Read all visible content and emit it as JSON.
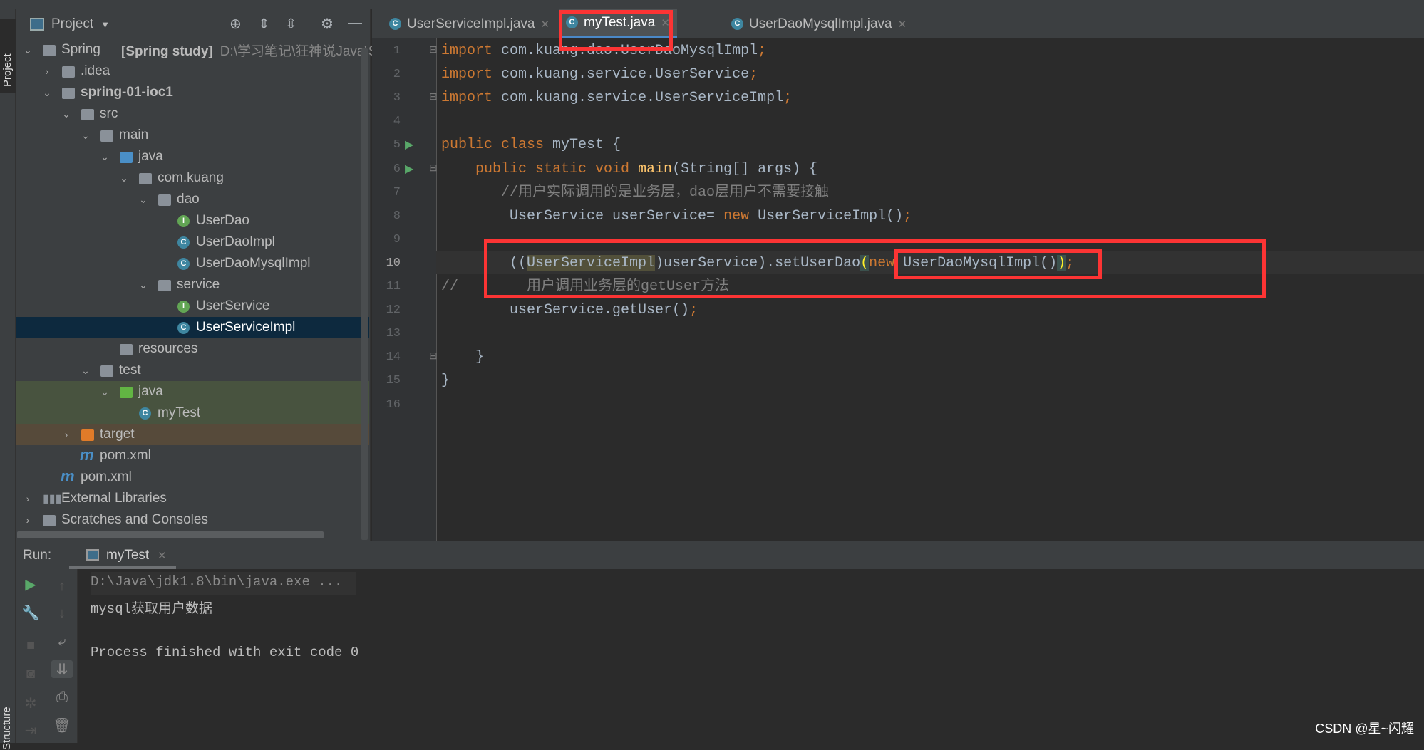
{
  "side_stripe": {
    "project_label": "Project",
    "structure_label": "Structure"
  },
  "project_panel": {
    "title": "Project",
    "tree": [
      {
        "depth": 0,
        "arrow": "down",
        "icon": "module",
        "label": "Spring",
        "bold_suffix": "[Spring study]",
        "path": "D:\\学习笔记\\狂神说Java\\Spr"
      },
      {
        "depth": 1,
        "arrow": "right",
        "icon": "folder",
        "label": ".idea"
      },
      {
        "depth": 1,
        "arrow": "down",
        "icon": "module",
        "label": "spring-01-ioc1",
        "bold": true
      },
      {
        "depth": 2,
        "arrow": "down",
        "icon": "folder",
        "label": "src"
      },
      {
        "depth": 3,
        "arrow": "down",
        "icon": "folder",
        "label": "main"
      },
      {
        "depth": 4,
        "arrow": "down",
        "icon": "source-folder",
        "label": "java"
      },
      {
        "depth": 5,
        "arrow": "down",
        "icon": "package",
        "label": "com.kuang"
      },
      {
        "depth": 6,
        "arrow": "down",
        "icon": "package",
        "label": "dao"
      },
      {
        "depth": 7,
        "icon": "interface",
        "label": "UserDao"
      },
      {
        "depth": 7,
        "icon": "class",
        "label": "UserDaoImpl"
      },
      {
        "depth": 7,
        "icon": "class",
        "label": "UserDaoMysqlImpl"
      },
      {
        "depth": 6,
        "arrow": "down",
        "icon": "package",
        "label": "service"
      },
      {
        "depth": 7,
        "icon": "interface",
        "label": "UserService"
      },
      {
        "depth": 7,
        "icon": "class",
        "label": "UserServiceImpl",
        "selected": true
      },
      {
        "depth": 4,
        "icon": "resources-folder",
        "label": "resources"
      },
      {
        "depth": 3,
        "arrow": "down",
        "icon": "folder",
        "label": "test"
      },
      {
        "depth": 4,
        "arrow": "down",
        "icon": "test-folder",
        "label": "java",
        "test": true
      },
      {
        "depth": 5,
        "icon": "test-class",
        "label": "myTest",
        "test": true
      },
      {
        "depth": 2,
        "arrow": "right",
        "icon": "excluded-folder",
        "label": "target",
        "excluded": true
      },
      {
        "depth": 2,
        "icon": "maven",
        "label": "pom.xml"
      },
      {
        "depth": 1,
        "icon": "maven",
        "label": "pom.xml"
      },
      {
        "depth": 0,
        "arrow": "right",
        "icon": "libraries",
        "label": "External Libraries"
      },
      {
        "depth": 0,
        "arrow": "right",
        "icon": "scratches",
        "label": "Scratches and Consoles"
      }
    ]
  },
  "editor_tabs": [
    {
      "label": "UserServiceImpl.java",
      "active": false
    },
    {
      "label": "myTest.java",
      "active": true
    },
    {
      "label": "UserDaoMysqlImpl.java",
      "active": false
    }
  ],
  "code_lines": [
    {
      "n": "1",
      "tokens": [
        [
          "import",
          "kw"
        ],
        [
          " com.kuang.dao.UserDaoMysqlImpl",
          "tx"
        ],
        [
          ";",
          "kw"
        ]
      ]
    },
    {
      "n": "2",
      "tokens": [
        [
          "import",
          "kw"
        ],
        [
          " com.kuang.service.UserService",
          "tx"
        ],
        [
          ";",
          "kw"
        ]
      ]
    },
    {
      "n": "3",
      "tokens": [
        [
          "import",
          "kw"
        ],
        [
          " com.kuang.service.UserServiceImpl",
          "tx"
        ],
        [
          ";",
          "kw"
        ]
      ]
    },
    {
      "n": "4",
      "tokens": []
    },
    {
      "n": "5",
      "tokens": [
        [
          "public class",
          "kw"
        ],
        [
          " myTest {",
          "tx"
        ]
      ]
    },
    {
      "n": "6",
      "tokens": [
        [
          "    public static void ",
          "kw"
        ],
        [
          "main",
          "fn"
        ],
        [
          "(String[] args) {",
          "tx"
        ]
      ]
    },
    {
      "n": "7",
      "tokens": [
        [
          "       //用户实际调用的是业务层，dao层用户不需要接触",
          "cm"
        ]
      ]
    },
    {
      "n": "8",
      "tokens": [
        [
          "        UserService userService= ",
          "tx"
        ],
        [
          "new ",
          "kw"
        ],
        [
          "UserServiceImpl()",
          "tx"
        ],
        [
          ";",
          "kw"
        ]
      ]
    },
    {
      "n": "9",
      "tokens": []
    },
    {
      "n": "10",
      "tokens": [
        [
          "        ((",
          "tx"
        ],
        [
          "UserServiceImpl",
          "tx hl"
        ],
        [
          ")userService).setUserDao",
          "tx"
        ],
        [
          "(",
          "br"
        ],
        [
          "new ",
          "kw"
        ],
        [
          "UserDaoMysqlImpl()",
          "tx"
        ],
        [
          ")",
          "br"
        ],
        [
          ";",
          "kw"
        ]
      ]
    },
    {
      "n": "11",
      "tokens": [
        [
          "//        ",
          "cm"
        ],
        [
          "用户调用业务层的getUser方法",
          "cm"
        ]
      ]
    },
    {
      "n": "12",
      "tokens": [
        [
          "        userService.getUser()",
          "tx"
        ],
        [
          ";",
          "kw"
        ]
      ]
    },
    {
      "n": "13",
      "tokens": []
    },
    {
      "n": "14",
      "tokens": [
        [
          "    }",
          "tx"
        ]
      ]
    },
    {
      "n": "15",
      "tokens": [
        [
          "}",
          "tx"
        ]
      ]
    },
    {
      "n": "16",
      "tokens": []
    }
  ],
  "run_panel": {
    "label": "Run:",
    "tab": "myTest",
    "console": [
      "D:\\Java\\jdk1.8\\bin\\java.exe ...",
      "mysql获取用户数据",
      "",
      "Process finished with exit code 0"
    ]
  },
  "watermark": "CSDN @星~闪耀",
  "colors": {
    "highlight_box": "#fc3434",
    "keyword": "#cc7832",
    "selection": "#0d293e"
  }
}
